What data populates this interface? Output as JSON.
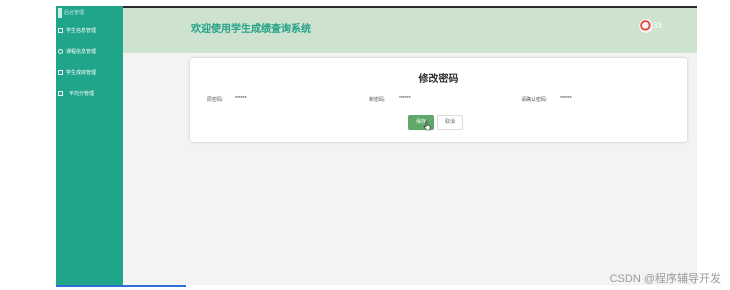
{
  "app": {
    "title": "欢迎使用学生成绩查询系统",
    "username": "33"
  },
  "sidebar": {
    "logo_text": "后台管理",
    "items": [
      {
        "label": "学生信息管理",
        "icon": "list-icon"
      },
      {
        "label": "课程信息管理",
        "icon": "book-icon"
      },
      {
        "label": "学生成绩管理",
        "icon": "grade-icon"
      },
      {
        "label": "平均分管理",
        "icon": "average-icon"
      }
    ]
  },
  "form": {
    "title": "修改密码",
    "old_label": "原密码:",
    "old_value": "******",
    "new_label": "新密码:",
    "new_value": "******",
    "confirm_label": "请确认密码:",
    "confirm_value": "******",
    "save_label": "保存",
    "cancel_label": "取消"
  },
  "watermark": "CSDN @程序辅导开发",
  "colors": {
    "sidebar": "#20a58a",
    "header": "#cde3d0",
    "title": "#23a085",
    "save_button": "#5fa86a"
  }
}
